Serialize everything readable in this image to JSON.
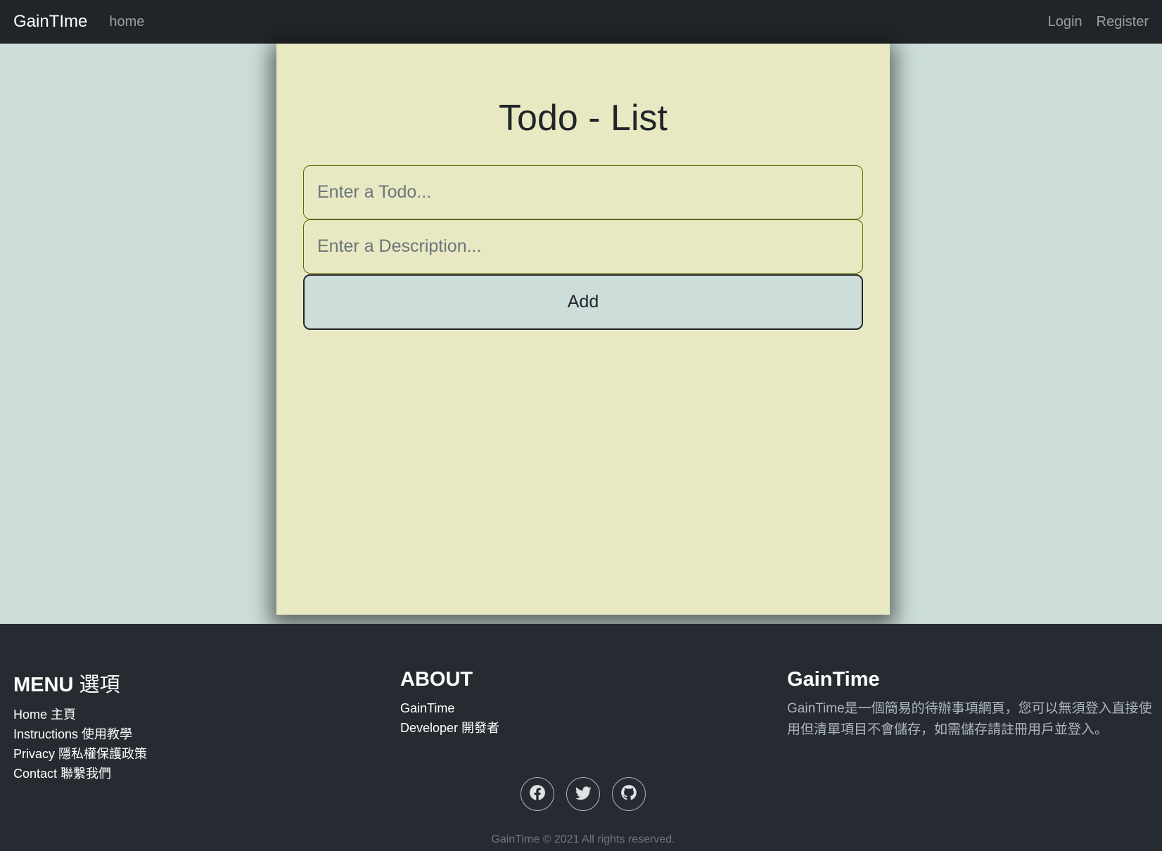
{
  "navbar": {
    "brand": "GainTIme",
    "home": "home",
    "login": "Login",
    "register": "Register"
  },
  "todo": {
    "title": "Todo - List",
    "todo_placeholder": "Enter a Todo...",
    "todo_value": "",
    "description_placeholder": "Enter a Description...",
    "description_value": "",
    "add_label": "Add"
  },
  "footer": {
    "menu": {
      "heading_en": "MENU",
      "heading_zh": "選項",
      "items": [
        {
          "label": "Home 主頁"
        },
        {
          "label": "Instructions 使用教學"
        },
        {
          "label": "Privacy 隱私權保護政策"
        },
        {
          "label": "Contact 聯繫我們"
        }
      ]
    },
    "about": {
      "heading": "ABOUT",
      "items": [
        {
          "label": "GainTime"
        },
        {
          "label": "Developer 開發者"
        }
      ]
    },
    "brand": {
      "heading": "GainTime",
      "description": "GainTime是一個簡易的待辦事項網頁，您可以無須登入直接使用但清單項目不會儲存，如需儲存請註冊用戶並登入。"
    },
    "socials": [
      {
        "icon": "facebook-icon"
      },
      {
        "icon": "twitter-icon"
      },
      {
        "icon": "github-icon"
      }
    ],
    "copyright": "GainTime © 2021 All rights reserved."
  },
  "colors": {
    "navbar_bg": "#212529",
    "page_bg": "#cddeda",
    "card_bg": "#e8e9c2",
    "footer_bg": "#262b31",
    "input_border": "#5a6a00"
  }
}
